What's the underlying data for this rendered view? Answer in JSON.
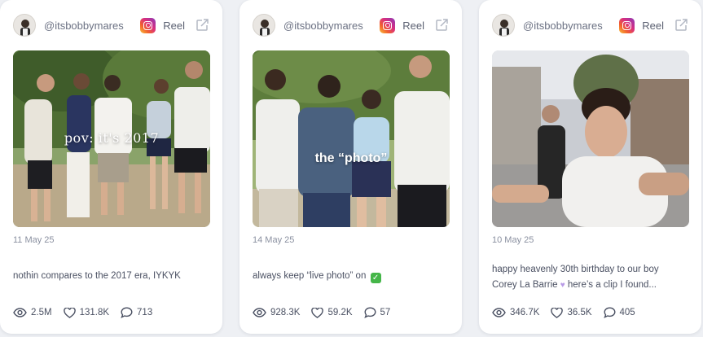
{
  "cards": [
    {
      "handle": "@itsbobbymares",
      "type_label": "Reel",
      "overlay_text": "pov: it's 2017",
      "date": "11 May 25",
      "caption": "nothin compares to the 2017 era, IYKYK",
      "views": "2.5M",
      "likes": "131.8K",
      "comments": "713"
    },
    {
      "handle": "@itsbobbymares",
      "type_label": "Reel",
      "overlay_text": "the “photo”",
      "date": "14 May 25",
      "caption": "always keep “live photo” on",
      "views": "928.3K",
      "likes": "59.2K",
      "comments": "57"
    },
    {
      "handle": "@itsbobbymares",
      "type_label": "Reel",
      "overlay_text": "",
      "date": "10 May 25",
      "caption_line1": "happy heavenly 30th birthday to our boy",
      "caption_line2_a": "Corey La Barrie",
      "caption_line2_b": " here’s a clip I found...",
      "views": "346.7K",
      "likes": "36.5K",
      "comments": "405"
    }
  ],
  "icons": {
    "platform": "instagram-icon",
    "open": "external-link-icon",
    "views": "eye-icon",
    "likes": "heart-icon",
    "comments": "comment-bubble-icon"
  },
  "colors": {
    "background": "#eef0f4",
    "card": "#ffffff",
    "muted_text": "#8a90a0",
    "text": "#4a5062"
  }
}
